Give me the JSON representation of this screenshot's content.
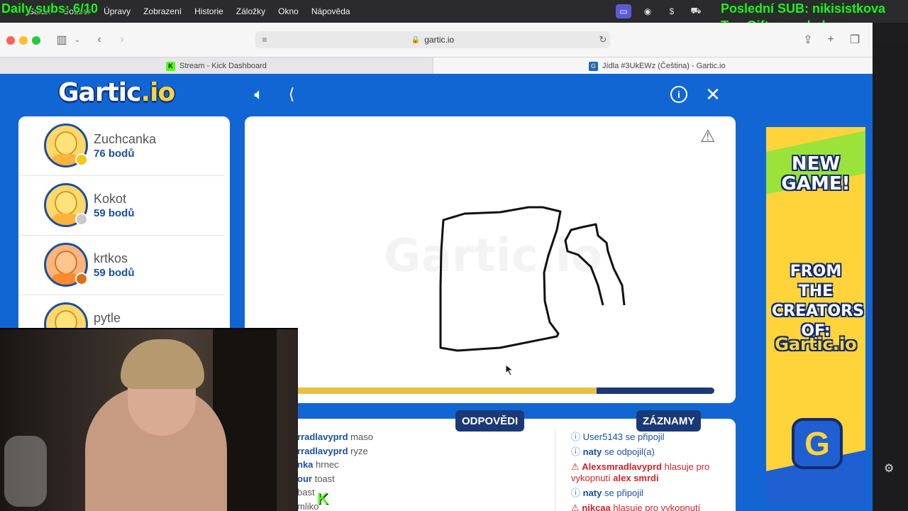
{
  "overlay": {
    "daily_subs": "Daily subs: 6/10",
    "last_sub": "Poslední SUB: nikisistkova",
    "top_gifter": "Top Gifter: malydano"
  },
  "menubar": {
    "items": [
      "Safari",
      "Soubor",
      "Úpravy",
      "Zobrazení",
      "Historie",
      "Záložky",
      "Okno",
      "Nápověda"
    ]
  },
  "browser": {
    "url": "gartic.io",
    "tabs": [
      {
        "label": "Stream - Kick Dashboard"
      },
      {
        "label": "Jídla #3UkEWz (Čeština) - Gartic.io"
      }
    ]
  },
  "game": {
    "logo_main": "Gartic",
    "logo_suffix": ".io",
    "watermark": "Gartic.io",
    "players": [
      {
        "name": "Zuchcanka",
        "points": "76 bodů",
        "medal_color": "#f5c518"
      },
      {
        "name": "Kokot",
        "points": "59 bodů",
        "medal_color": "#c9c9c9"
      },
      {
        "name": "krtkos",
        "points": "59 bodů",
        "medal_color": "#d9711c"
      },
      {
        "name": "pytle",
        "points": ""
      }
    ],
    "timer_progress": 0.72,
    "answers_button": "ODPOVĚDI",
    "records_button": "ZÁZNAMY",
    "answers": [
      {
        "user": "rradlavyprd",
        "word": "maso"
      },
      {
        "user": "rradlavyprd",
        "word": "ryze"
      },
      {
        "user": "nka",
        "word": "hrnec"
      },
      {
        "user": "our",
        "word": "toast"
      },
      {
        "user": "",
        "word": "bast"
      },
      {
        "user": "",
        "word": "mliko"
      }
    ],
    "logs": [
      {
        "user": "User5143",
        "text": "se připojil"
      },
      {
        "user": "naty",
        "text": "se odpojil(a)"
      },
      {
        "user": "Alexsmradlavyprd",
        "text": "hlasuje pro vykopnutí",
        "target": "alex smrdi"
      },
      {
        "user": "naty",
        "text": "se připojil"
      },
      {
        "user": "nikcaa",
        "text": "hlasuje pro vykopnutí"
      }
    ]
  },
  "ad": {
    "line1": "NEW GAME!",
    "line2": "FROM THE CREATORS OF:",
    "brand": "Gartic.io",
    "icon_letter": "G"
  },
  "colors": {
    "page_blue": "#1266d4",
    "navy": "#1b3a75",
    "timer_yellow": "#e8c045",
    "overlay_green": "#35e23a"
  }
}
